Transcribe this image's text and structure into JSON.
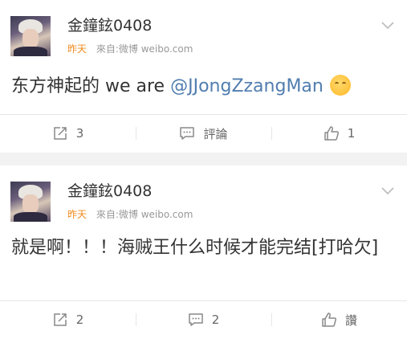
{
  "posts": [
    {
      "username": "金鐘鉉0408",
      "time": "昨天",
      "source": "來自:微博 weibo.com",
      "text": "东方神起的 we are ",
      "mention": "@JJongZzangMan",
      "emoji": "shy-smile-emoji",
      "actions": {
        "repost": "3",
        "comment": "評論",
        "like": "1"
      }
    },
    {
      "username": "金鐘鉉0408",
      "time": "昨天",
      "source": "來自:微博 weibo.com",
      "text": "就是啊！！！海贼王什么时候才能完结[打哈欠]",
      "actions": {
        "repost": "2",
        "comment": "2",
        "like": "讚"
      }
    }
  ],
  "icons": {
    "repost": "repost-icon",
    "comment": "comment-icon",
    "like": "thumbs-up-icon",
    "menu": "chevron-down-icon"
  },
  "colors": {
    "background": "#f2f2f2",
    "card": "#ffffff",
    "time_accent": "#f28b1e",
    "mention": "#507daf",
    "muted_text": "#999999"
  }
}
